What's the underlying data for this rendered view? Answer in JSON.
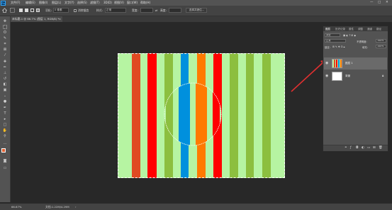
{
  "app": {
    "logo": "Ps"
  },
  "menu": [
    "文件(F)",
    "编辑(E)",
    "图像(I)",
    "图层(L)",
    "文字(Y)",
    "选择(S)",
    "滤镜(T)",
    "3D(D)",
    "视图(V)",
    "窗口(W)",
    "帮助(H)"
  ],
  "window_controls": {
    "minimize": "—",
    "maximize": "□",
    "close": "✕"
  },
  "options": {
    "feather_label": "羽化:",
    "feather_value": "0 像素",
    "antialias_label": "消除锯齿",
    "style_label": "样式:",
    "style_value": "正常",
    "width_label": "宽度:",
    "height_label": "高度:",
    "select_mask_button": "选择并遮住..."
  },
  "document_tab": {
    "title": "未标题-1 @ 66.7% (图层 1, RGB/8) *",
    "close": "×"
  },
  "status": {
    "zoom": "66.67%",
    "doc_info": "文档:1.22M/4.29M",
    "arrow": "›"
  },
  "layers_panel": {
    "tabs": [
      "图层",
      "历史记录",
      "属性",
      "调整",
      "通道",
      "路径"
    ],
    "kind_filter": "类型",
    "blend_mode": "正常",
    "opacity_label": "不透明度:",
    "opacity_value": "100%",
    "lock_label": "锁定:",
    "fill_label": "填充:",
    "fill_value": "100%",
    "layers": [
      {
        "name": "图层 1",
        "selected": true,
        "visible": true,
        "locked": false
      },
      {
        "name": "背景",
        "selected": false,
        "visible": true,
        "locked": true
      }
    ]
  },
  "colors": {
    "stripe_green_light": "#b6f4a2",
    "stripe_orange": "#e04a22",
    "stripe_red": "#ff0000",
    "stripe_olive": "#8cbf3f",
    "stripe_blue": "#0090dd",
    "stripe_orange_bright": "#ff7a00",
    "annotation_arrow": "#e03030",
    "foreground": "#e06030",
    "background": "#ffffff"
  }
}
